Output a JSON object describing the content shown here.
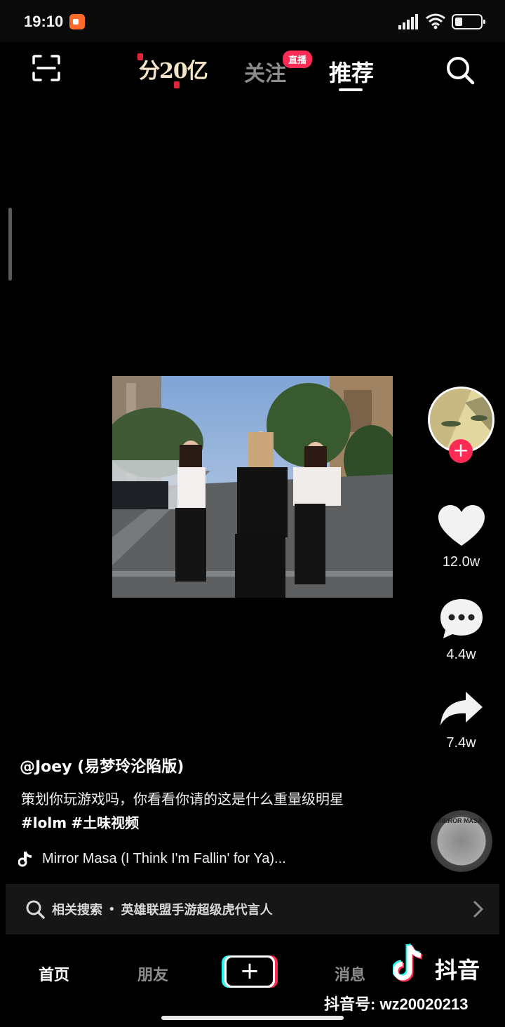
{
  "status_bar": {
    "time": "19:10"
  },
  "top_nav": {
    "promo_text": "分20亿",
    "tabs": [
      {
        "label": "关注",
        "badge": "直播"
      },
      {
        "label": "推荐"
      }
    ],
    "active_tab": "推荐"
  },
  "video": {
    "author": "@Joey (易梦玲沦陷版)",
    "caption_text": "策划你玩游戏吗，你看看你请的这是什么重量级明星",
    "hashtags": [
      "#lolm",
      "#土味视频"
    ],
    "music": "Mirror Masa (I Think I'm Fallin' for Ya)...",
    "disc_label": "MIRROR MASA"
  },
  "actions": {
    "likes": "12.0w",
    "comments": "4.4w",
    "shares": "7.4w"
  },
  "related_search": {
    "label": "相关搜索",
    "separator": "•",
    "query": "英雄联盟手游超级虎代言人"
  },
  "bottom_nav": {
    "items": [
      "首页",
      "朋友",
      "消息"
    ],
    "create_label": "+"
  },
  "watermark": {
    "brand": "抖音",
    "id_text": "抖音号: wz20020213"
  },
  "colors": {
    "accent_red": "#fe2c55",
    "accent_cyan": "#25f4ee",
    "background": "#000000"
  }
}
